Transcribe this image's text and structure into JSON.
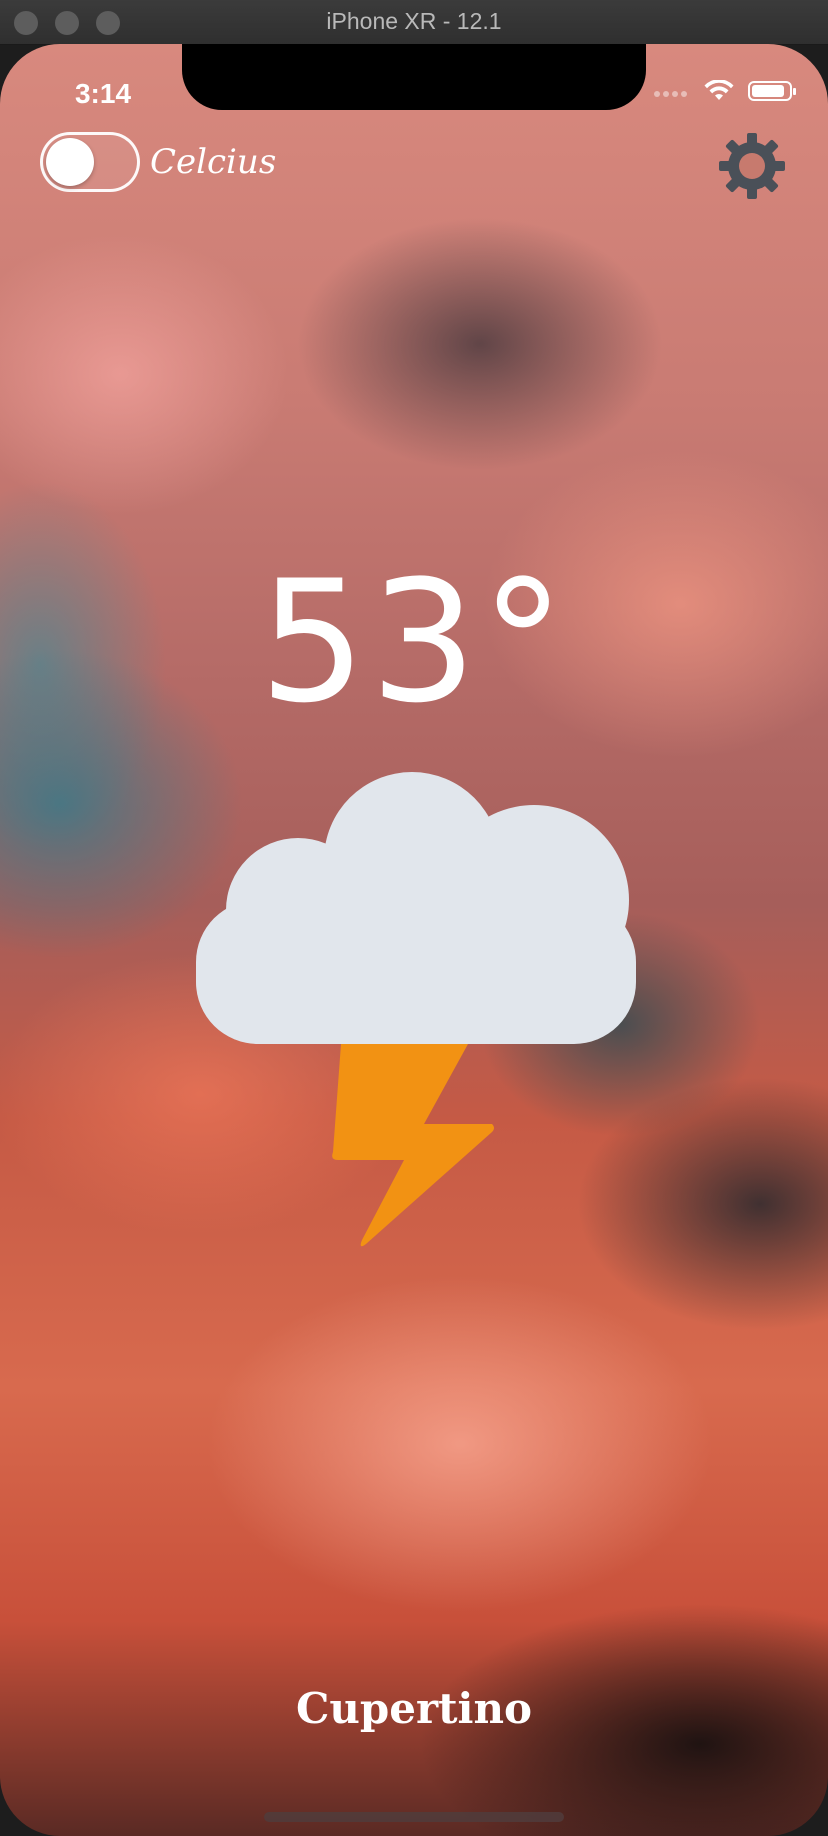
{
  "window": {
    "title": "iPhone XR - 12.1"
  },
  "status_bar": {
    "time": "3:14",
    "battery_level": 0.9
  },
  "toggle": {
    "label": "Celcius",
    "on": false
  },
  "weather": {
    "temperature": "53°",
    "condition_icon": "thunderstorm-icon"
  },
  "location": {
    "city": "Cupertino"
  },
  "colors": {
    "cloud": "#e1e6ec",
    "bolt": "#f29213",
    "gear": "#4a5058",
    "text": "#ffffff"
  }
}
